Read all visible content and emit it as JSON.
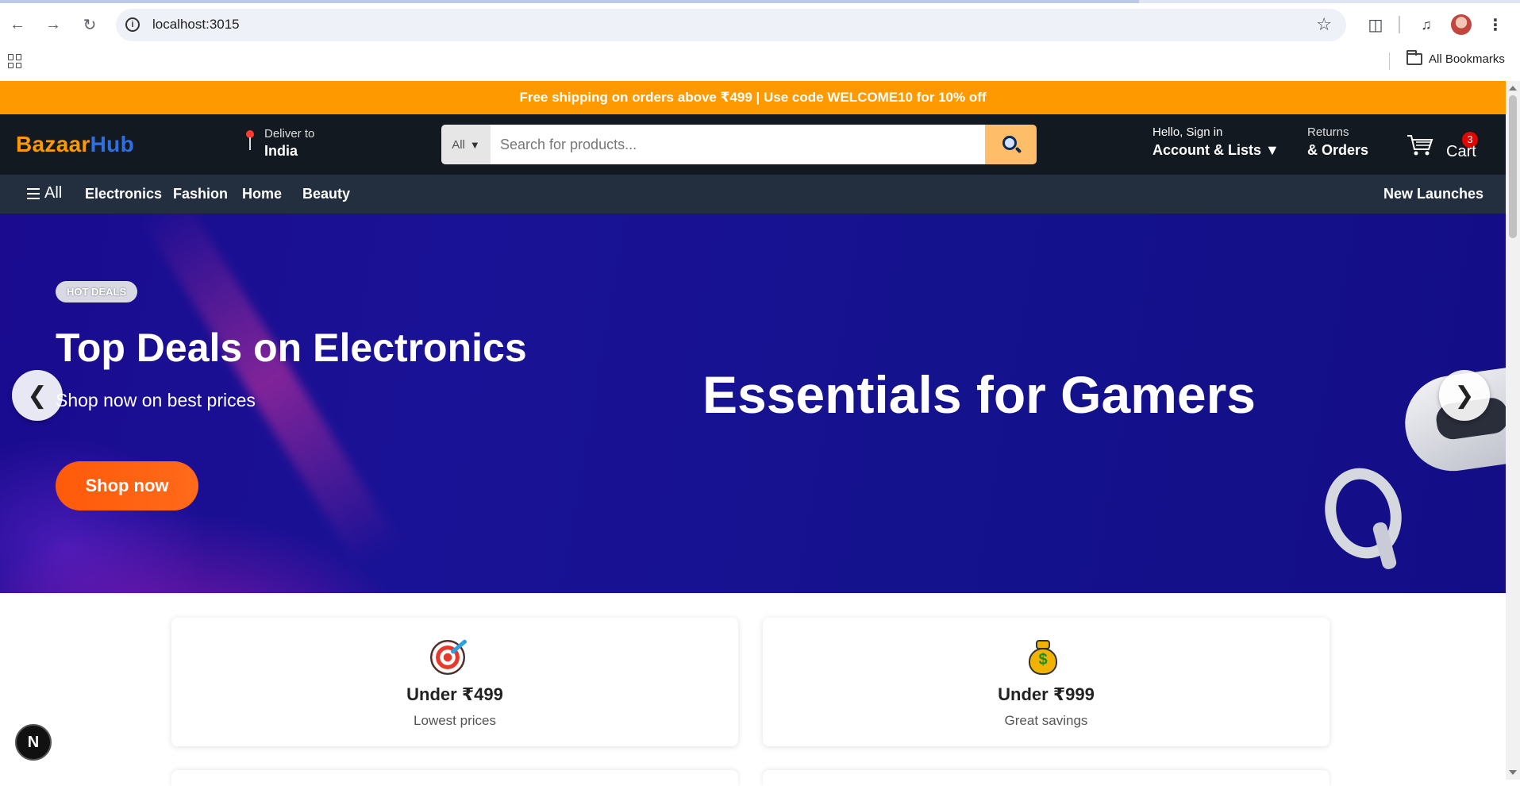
{
  "browser": {
    "url": "localhost:3015",
    "bookmarks_label": "All Bookmarks"
  },
  "promo": {
    "text": "Free shipping on orders above ₹499 | Use code WELCOME10 for 10% off"
  },
  "header": {
    "logo_part1": "Bazaar",
    "logo_part2": "Hub",
    "deliver_label": "Deliver to",
    "deliver_location": "India",
    "search_category": "All",
    "search_placeholder": "Search for products...",
    "account_greeting": "Hello, Sign in",
    "account_label": "Account & Lists ▼",
    "returns_label": "Returns",
    "orders_label": "& Orders",
    "cart_label": "Cart",
    "cart_count": "3"
  },
  "subnav": {
    "all_label": "All",
    "items": [
      "Electronics",
      "Fashion",
      "Home",
      "Beauty"
    ],
    "right_item": "New Launches"
  },
  "hero": {
    "badge": "HOT DEALS",
    "title": "Top Deals on Electronics",
    "subtitle": "Shop now on best prices",
    "cta": "Shop now",
    "banner_text": "Essentials for Gamers",
    "prev_arrow": "❮",
    "next_arrow": "❯",
    "slide_count": 5,
    "active_slide": 2
  },
  "cards": [
    {
      "icon": "target-icon",
      "title": "Under ₹499",
      "subtitle": "Lowest prices"
    },
    {
      "icon": "moneybag-icon",
      "title": "Under ₹999",
      "subtitle": "Great savings"
    }
  ],
  "dev_badge": "N",
  "colors": {
    "promo_bg": "#ff9900",
    "header_bg": "#131921",
    "subnav_bg": "#232f3e",
    "search_button": "#febd69",
    "cta_orange": "#ff5a0a",
    "hero_bg": "#1a1296"
  }
}
